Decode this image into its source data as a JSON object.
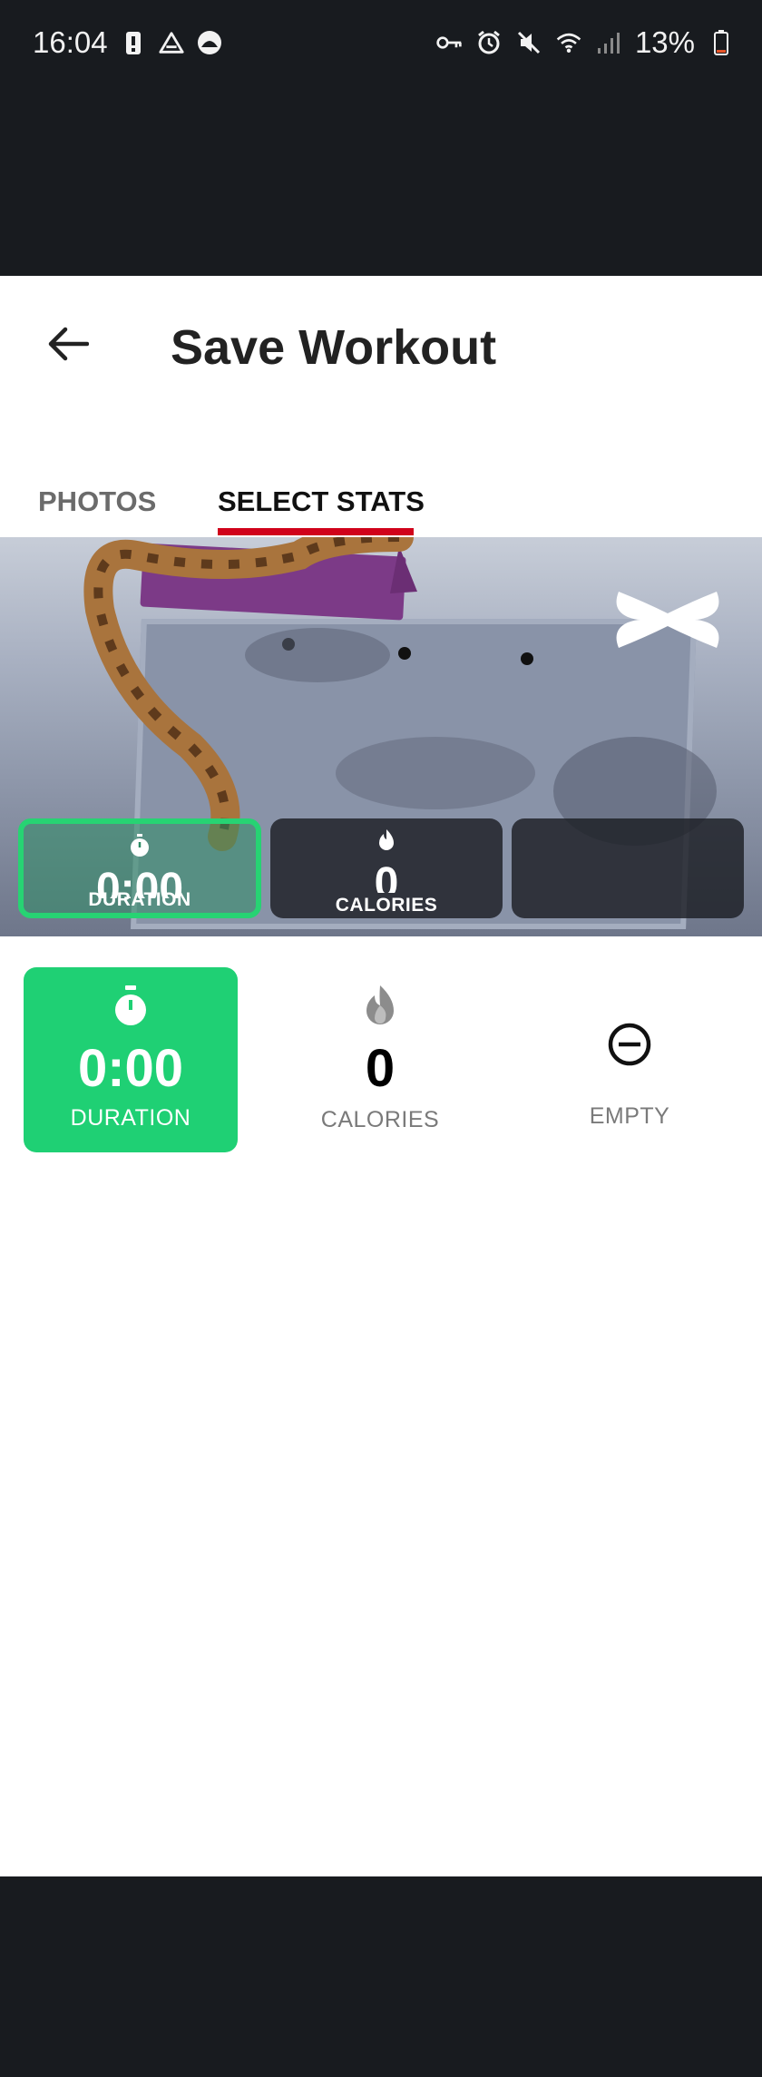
{
  "status": {
    "time": "16:04",
    "battery": "13%"
  },
  "header": {
    "title": "Save Workout"
  },
  "tabs": [
    {
      "label": "PHOTOS",
      "active": false
    },
    {
      "label": "SELECT STATS",
      "active": true
    }
  ],
  "overlay": {
    "cards": [
      {
        "value": "0:00",
        "label": "DURATION",
        "icon": "stopwatch-icon",
        "active": true
      },
      {
        "value": "0",
        "label": "CALORIES",
        "icon": "flame-icon",
        "active": false
      },
      {
        "value": "",
        "label": "",
        "icon": "",
        "active": false
      }
    ]
  },
  "stats": [
    {
      "value": "0:00",
      "label": "DURATION",
      "icon": "stopwatch-icon",
      "selected": true
    },
    {
      "value": "0",
      "label": "CALORIES",
      "icon": "flame-icon",
      "selected": false
    },
    {
      "value": "",
      "label": "EMPTY",
      "icon": "minus-circle-icon",
      "selected": false
    }
  ],
  "colors": {
    "accent_green": "#1fd074",
    "tab_underline": "#d0021b",
    "system_bar": "#181b1f"
  }
}
